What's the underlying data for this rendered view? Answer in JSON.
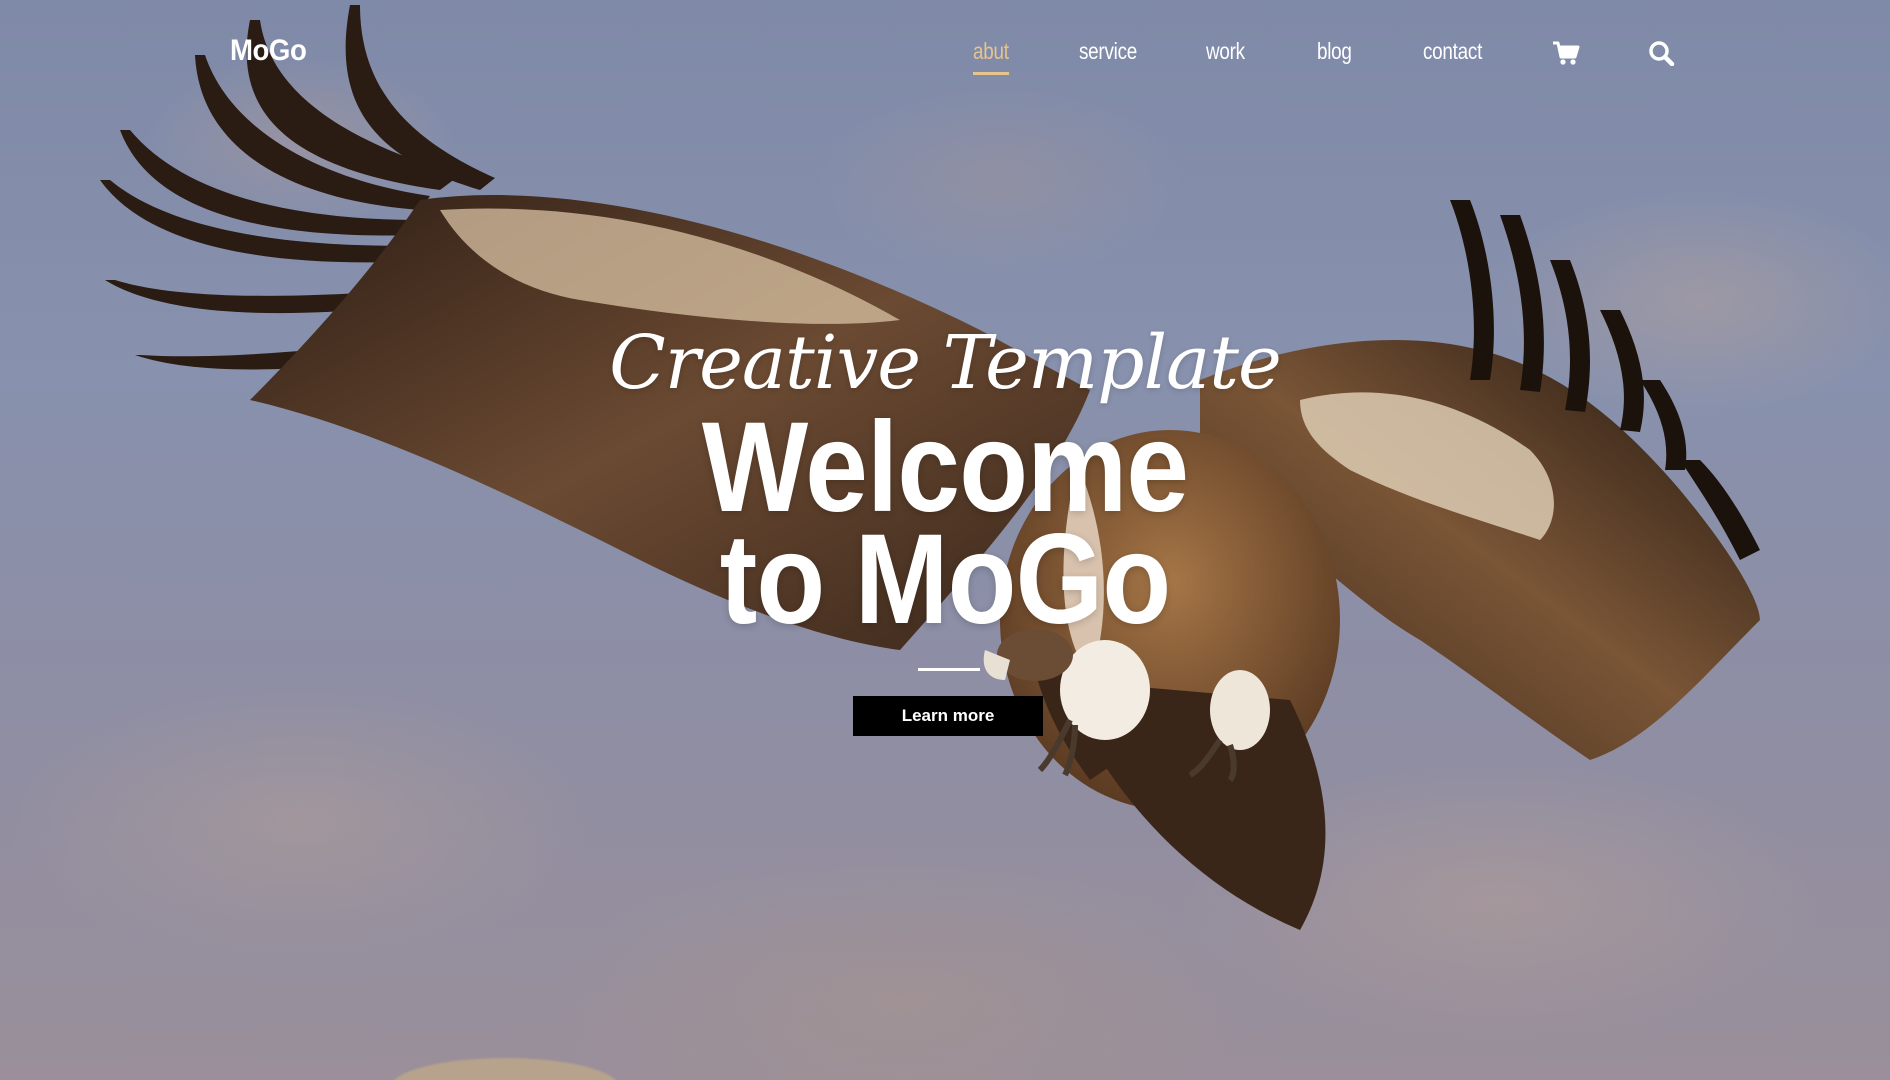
{
  "header": {
    "logo": "MoGo",
    "nav": [
      {
        "label": "abut",
        "active": true
      },
      {
        "label": "service",
        "active": false
      },
      {
        "label": "work",
        "active": false
      },
      {
        "label": "blog",
        "active": false
      },
      {
        "label": "contact",
        "active": false
      }
    ],
    "icons": [
      "cart-icon",
      "search-icon"
    ]
  },
  "hero": {
    "script_text": "Creative Template",
    "title_line1": "Welcome",
    "title_line2": "to MoGo",
    "button_label": "Learn more",
    "background_image": "vulture in flight against a cloudy sky"
  },
  "colors": {
    "accent": "#e7c38d",
    "text": "#ffffff",
    "button_bg": "#000000"
  }
}
